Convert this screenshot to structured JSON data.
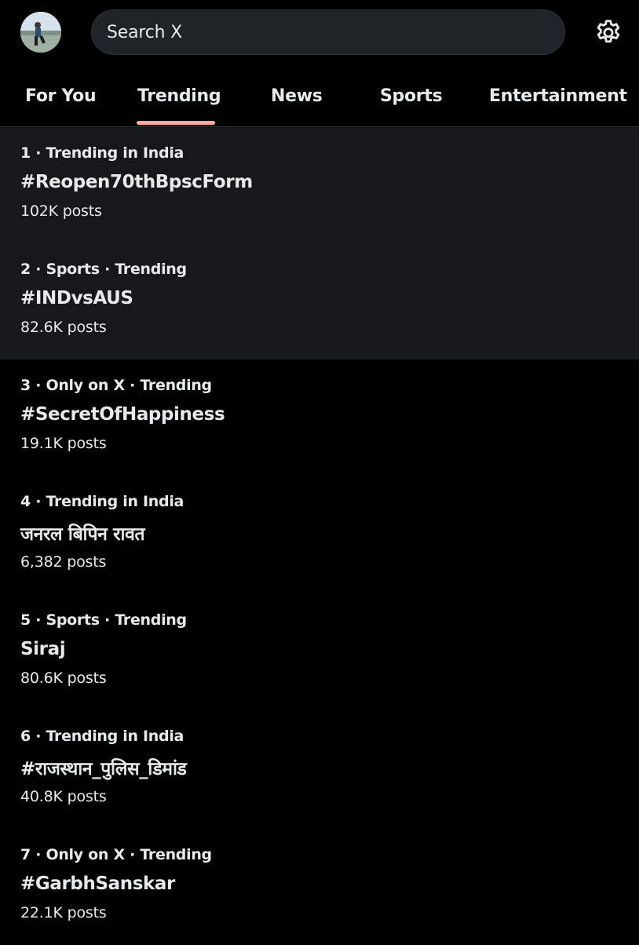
{
  "header": {
    "search_placeholder": "Search X"
  },
  "tabs": [
    {
      "label": "For You"
    },
    {
      "label": "Trending",
      "active": true
    },
    {
      "label": "News"
    },
    {
      "label": "Sports"
    },
    {
      "label": "Entertainment"
    }
  ],
  "trends": [
    {
      "meta": "1 · Trending in India",
      "topic": "#Reopen70thBpscForm",
      "count": "102K posts"
    },
    {
      "meta": "2 · Sports · Trending",
      "topic": "#INDvsAUS",
      "count": "82.6K posts"
    },
    {
      "meta": "3 · Only on X · Trending",
      "topic": "#SecretOfHappiness",
      "count": "19.1K posts"
    },
    {
      "meta": "4 · Trending in India",
      "topic": "जनरल बिपिन रावत",
      "count": "6,382 posts"
    },
    {
      "meta": "5 · Sports · Trending",
      "topic": "Siraj",
      "count": "80.6K posts"
    },
    {
      "meta": "6 · Trending in India",
      "topic": "#राजस्थान_पुलिस_डिमांड",
      "count": "40.8K posts"
    },
    {
      "meta": "7 · Only on X · Trending",
      "topic": "#GarbhSanskar",
      "count": "22.1K posts"
    }
  ],
  "icons": {
    "avatar": "profile-avatar",
    "settings": "gear-icon"
  },
  "colors": {
    "background": "#000000",
    "highlight_row": "#16181c",
    "search_bg": "#202327",
    "active_tab_underline": "#f4a99b",
    "text": "#e7e9ea"
  }
}
